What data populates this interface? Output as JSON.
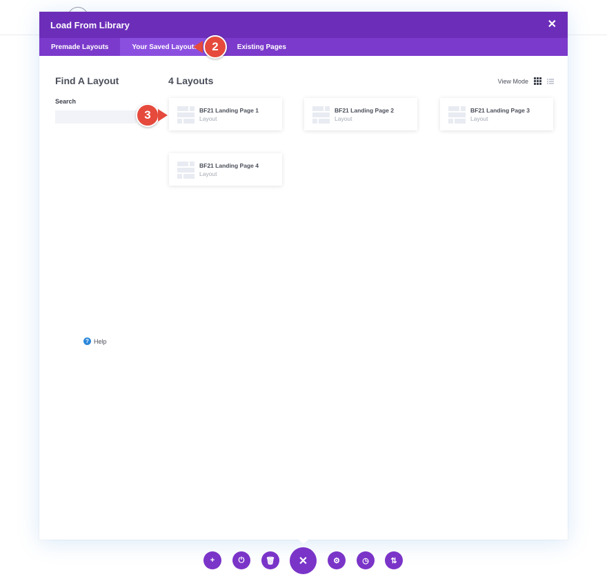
{
  "modal": {
    "title": "Load From Library",
    "close_glyph": "✕"
  },
  "tabs": [
    {
      "label": "Premade Layouts",
      "active": false
    },
    {
      "label": "Your Saved Layouts",
      "active": true
    },
    {
      "label": "Existing Pages",
      "active": false
    }
  ],
  "sidebar": {
    "title": "Find A Layout",
    "search_label": "Search",
    "search_value": "",
    "help_label": "Help"
  },
  "main": {
    "count_title": "4 Layouts",
    "view_mode_label": "View Mode",
    "cards": [
      {
        "name": "BF21 Landing Page 1",
        "type": "Layout"
      },
      {
        "name": "BF21 Landing Page 2",
        "type": "Layout"
      },
      {
        "name": "BF21 Landing Page 3",
        "type": "Layout"
      },
      {
        "name": "BF21 Landing Page 4",
        "type": "Layout"
      }
    ]
  },
  "callouts": [
    "2",
    "3"
  ],
  "toolbar": {
    "add_icon": "+",
    "power_icon": "⏻",
    "trash_icon": "🗑",
    "close_icon": "✕",
    "gear_icon": "⚙",
    "history_icon": "◷",
    "sort_icon": "⇅"
  },
  "colors": {
    "header": "#6c2eb9",
    "tabs": "#7b3acb",
    "active_tab": "#8b4fe0",
    "callout": "#e54a3c",
    "toolbar": "#7a34c8"
  }
}
